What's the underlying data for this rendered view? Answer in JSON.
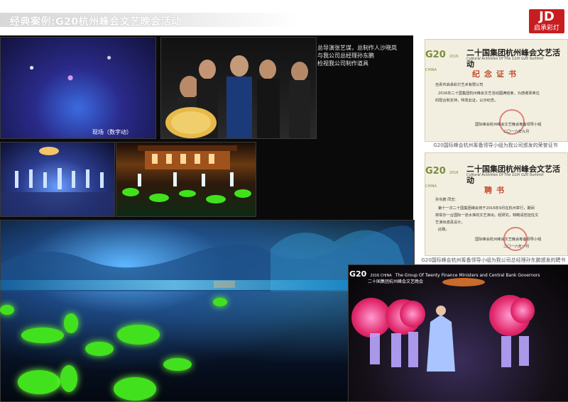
{
  "header": {
    "title": "经典案例:G20杭州峰会文艺晚会活动"
  },
  "logo": {
    "mark": "JD",
    "text": "启承彩灯"
  },
  "photos": {
    "p1_caption": "现场（数字动）"
  },
  "description": {
    "line1": "总导演张艺谋，总制作人沙晓岚",
    "line2": "与我公司总经理孙东鹏",
    "line3": "检视我公司制作道具"
  },
  "cert1": {
    "g20": "G20",
    "g20_sub": "2016 CHINA",
    "title": "二十国集团杭州峰会文艺活动",
    "title_en": "Cultural Activities Of The 11th G20 Summit",
    "name": "纪念证书",
    "recipient": "自贡市启承彩灯艺术有限公司",
    "body1": "2016年二十国集团杭州峰会文艺活动圆满结束，为感谢贵单位",
    "body2": "的配合和支持，特发此证，以示纪念。",
    "issuer": "国际峰会杭州峰会文艺晚会筹备领导小组",
    "date": "二〇一六年九月",
    "caption": "G20国际峰会杭州筹备领导小组为我公司颁发的荣誉证书"
  },
  "cert2": {
    "g20": "G20",
    "g20_sub": "2016 CHINA",
    "title": "二十国集团杭州峰会文艺活动",
    "title_en": "Cultural Activities Of The 11th G20 Summit",
    "name": "聘书",
    "recipient": "孙东鹏 同志：",
    "body1": "第十一次二十国集团峰会将于2016年9月在杭州举行，期间",
    "body2": "将举办一台国际一流水准的文艺演出。经研究，特聘请您担任文",
    "body3": "艺演出道具设计。",
    "body4": "此致。",
    "issuer": "国际峰会杭州峰会文艺晚会筹备领导小组",
    "date": "二〇一六年一月",
    "caption": "G20国际峰会杭州筹备领导小组为我公司总经理孙东鹏颁发的聘书"
  },
  "p5_banner": {
    "g20": "G20",
    "g20_sub": "2016 CHINA",
    "line1": "The Group Of Twenty Finance Ministers and Central Bank Governors",
    "line2": "二十国集团杭州峰会文艺晚会"
  },
  "colors": {
    "logo": "#c81d20",
    "lotus": "#41e21d",
    "umbrella": "#e2286b"
  }
}
